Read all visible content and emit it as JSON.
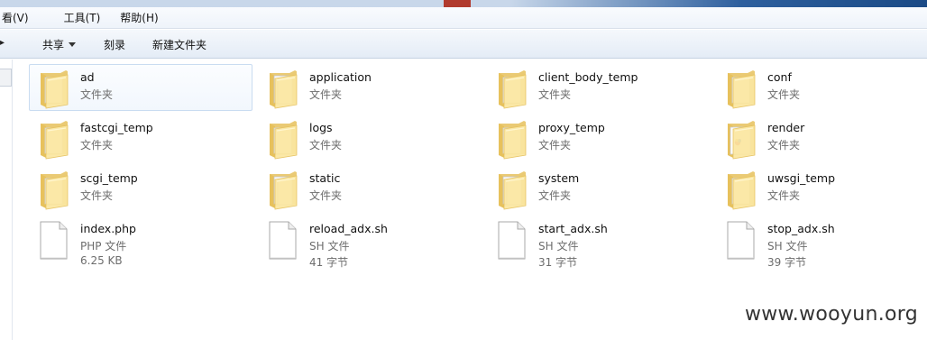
{
  "menubar": {
    "items": [
      {
        "label": "看(V)"
      },
      {
        "label": "工具(T)"
      },
      {
        "label": "帮助(H)"
      }
    ]
  },
  "commandbar": {
    "back_glyph": "▸",
    "share_label": "共享",
    "burn_label": "刻录",
    "new_folder_label": "新建文件夹"
  },
  "files": [
    {
      "name": "ad",
      "type": "文件夹",
      "size": "",
      "icon": "folder-icon",
      "selected": true
    },
    {
      "name": "application",
      "type": "文件夹",
      "size": "",
      "icon": "folder-with-files-icon"
    },
    {
      "name": "client_body_temp",
      "type": "文件夹",
      "size": "",
      "icon": "folder-icon"
    },
    {
      "name": "conf",
      "type": "文件夹",
      "size": "",
      "icon": "folder-icon"
    },
    {
      "name": "fastcgi_temp",
      "type": "文件夹",
      "size": "",
      "icon": "folder-icon"
    },
    {
      "name": "logs",
      "type": "文件夹",
      "size": "",
      "icon": "folder-icon"
    },
    {
      "name": "proxy_temp",
      "type": "文件夹",
      "size": "",
      "icon": "folder-icon"
    },
    {
      "name": "render",
      "type": "文件夹",
      "size": "",
      "icon": "folder-with-image-icon"
    },
    {
      "name": "scgi_temp",
      "type": "文件夹",
      "size": "",
      "icon": "folder-icon"
    },
    {
      "name": "static",
      "type": "文件夹",
      "size": "",
      "icon": "folder-with-files-icon"
    },
    {
      "name": "system",
      "type": "文件夹",
      "size": "",
      "icon": "folder-with-files-icon"
    },
    {
      "name": "uwsgi_temp",
      "type": "文件夹",
      "size": "",
      "icon": "folder-icon"
    },
    {
      "name": "index.php",
      "type": "PHP 文件",
      "size": "6.25 KB",
      "icon": "file-icon"
    },
    {
      "name": "reload_adx.sh",
      "type": "SH 文件",
      "size": "41 字节",
      "icon": "file-icon"
    },
    {
      "name": "start_adx.sh",
      "type": "SH 文件",
      "size": "31 字节",
      "icon": "file-icon"
    },
    {
      "name": "stop_adx.sh",
      "type": "SH 文件",
      "size": "39 字节",
      "icon": "file-icon"
    }
  ],
  "watermark": "www.wooyun.org",
  "colors": {
    "folder_light": "#fbe7a1",
    "folder_dark": "#e6c15c",
    "selection_border": "#c9dcf1",
    "secondary_text": "#6d6d6d"
  }
}
